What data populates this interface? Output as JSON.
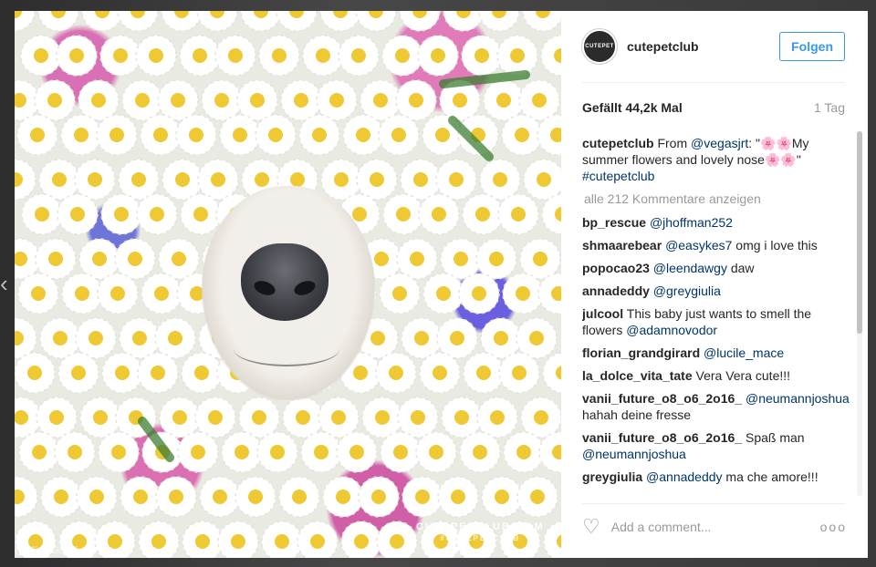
{
  "post": {
    "photo_watermark": "CUTEPETCLUB.COM",
    "photo_watermark_sub": "#CUTEPETCLUB",
    "photo_credit": "@VEGASJRT"
  },
  "header": {
    "avatar_text": "CUTEPET",
    "username": "cutepetclub",
    "follow_label": "Folgen"
  },
  "stats": {
    "likes": "Gefällt 44,2k Mal",
    "time": "1 Tag"
  },
  "caption": {
    "user": "cutepetclub",
    "text_before": " From ",
    "mention": "@vegasjrt",
    "text_after": ": \"🌸🌸My summer flowers and lovely nose🌸🌸\" ",
    "hashtag": "#cutepetclub"
  },
  "show_all": "alle 212 Kommentare anzeigen",
  "comments": [
    {
      "user": "bp_rescue",
      "mention": "@jhoffman252",
      "text": ""
    },
    {
      "user": "shmaarebear",
      "mention": "@easykes7",
      "text": " omg i love this"
    },
    {
      "user": "popocao23",
      "mention": "@leendawgy",
      "text": " daw"
    },
    {
      "user": "annadeddy",
      "mention": "@greygiulia",
      "text": ""
    },
    {
      "user": "julcool",
      "mention": "",
      "text": " This baby just wants to smell the flowers ",
      "mention2": "@adamnovodor"
    },
    {
      "user": "florian_grandgirard",
      "mention": "@lucile_mace",
      "text": ""
    },
    {
      "user": "la_dolce_vita_tate",
      "mention": "",
      "text": " Vera Vera cute!!!"
    },
    {
      "user": "vanii_future_o8_o6_2o16_",
      "mention": "@neumannjoshua",
      "text": " hahah deine fresse"
    },
    {
      "user": "vanii_future_o8_o6_2o16_",
      "mention": "",
      "text": " Spaß man ",
      "mention2": "@neumannjoshua"
    },
    {
      "user": "greygiulia",
      "mention": "@annadeddy",
      "text": " ma che amore!!!"
    }
  ],
  "add_comment": {
    "placeholder": "Add a comment...",
    "heart_icon": "heart-outline-icon",
    "options_label": "ooo"
  }
}
